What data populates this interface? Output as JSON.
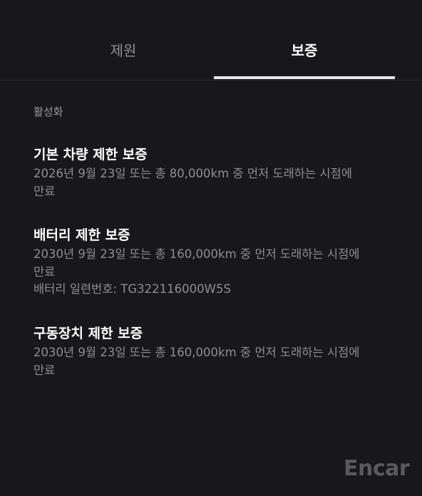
{
  "tabs": {
    "specs_label": "제원",
    "warranty_label": "보증"
  },
  "status_label": "활성화",
  "warranties": [
    {
      "title": "기본 차량 제한 보증",
      "detail_line1": "2026년 9월 23일 또는 총 80,000km 중 먼저 도래하는 시점에",
      "detail_line2": "만료"
    },
    {
      "title": "배터리 제한 보증",
      "detail_line1": "2030년 9월 23일 또는 총 160,000km 중 먼저 도래하는 시점에",
      "detail_line2": "만료",
      "detail_line3": "배터리 일련번호: TG322116000W5S"
    },
    {
      "title": "구동장치 제한 보증",
      "detail_line1": "2030년 9월 23일 또는 총 160,000km 중 먼저 도래하는 시점에",
      "detail_line2": "만료"
    }
  ],
  "watermark": "Encar",
  "colors": {
    "background": "#18181a",
    "active_tab_underline": "#e8e8ea",
    "muted_text": "#8e8e92"
  }
}
